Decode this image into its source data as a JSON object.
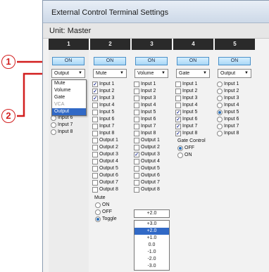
{
  "window": {
    "title": "External Control Terminal Settings",
    "unit_label": "Unit:",
    "unit_value": "Master"
  },
  "callouts": [
    "1",
    "2"
  ],
  "colors": {
    "accent": "#d21e1e",
    "selection": "#3169c6",
    "header": "#2a2a2a",
    "on_button": "#a9d7f6"
  },
  "columns": [
    {
      "number": "1",
      "on_label": "ON",
      "dropdown": "Output",
      "menu": [
        "Mute",
        "Volume",
        "Gate",
        "VCA",
        "Output"
      ],
      "menu_selected": "Output",
      "radios": [
        {
          "label": "Input 6",
          "selected": false
        },
        {
          "label": "Input 7",
          "selected": false
        },
        {
          "label": "Input 8",
          "selected": false
        }
      ]
    },
    {
      "number": "2",
      "on_label": "ON",
      "dropdown": "Mute",
      "items": [
        {
          "label": "Input 1",
          "checked": true
        },
        {
          "label": "Input 2",
          "checked": true
        },
        {
          "label": "Input 3",
          "checked": true
        },
        {
          "label": "Input 4",
          "checked": false
        },
        {
          "label": "Input 5",
          "checked": false
        },
        {
          "label": "Input 6",
          "checked": false
        },
        {
          "label": "Input 7",
          "checked": false
        },
        {
          "label": "Input 8",
          "checked": false
        },
        {
          "label": "Output 1",
          "checked": false
        },
        {
          "label": "Output 2",
          "checked": false
        },
        {
          "label": "Output 3",
          "checked": false
        },
        {
          "label": "Output 4",
          "checked": false
        },
        {
          "label": "Output 5",
          "checked": false
        },
        {
          "label": "Output 6",
          "checked": false
        },
        {
          "label": "Output 7",
          "checked": false
        },
        {
          "label": "Output 8",
          "checked": false
        }
      ],
      "group_label": "Mute",
      "group_options": [
        {
          "label": "ON",
          "selected": false
        },
        {
          "label": "OFF",
          "selected": false
        },
        {
          "label": "Toggle",
          "selected": true
        }
      ]
    },
    {
      "number": "3",
      "on_label": "ON",
      "dropdown": "Volume",
      "items": [
        {
          "label": "Input 1",
          "checked": false
        },
        {
          "label": "Input 2",
          "checked": false
        },
        {
          "label": "Input 3",
          "checked": false
        },
        {
          "label": "Input 4",
          "checked": false
        },
        {
          "label": "Input 5",
          "checked": false
        },
        {
          "label": "Input 6",
          "checked": false
        },
        {
          "label": "Input 7",
          "checked": false
        },
        {
          "label": "Input 8",
          "checked": false
        },
        {
          "label": "Output 1",
          "checked": false
        },
        {
          "label": "Output 2",
          "checked": false
        },
        {
          "label": "Output 3",
          "checked": true
        },
        {
          "label": "Output 4",
          "checked": false
        },
        {
          "label": "Output 5",
          "checked": false
        },
        {
          "label": "Output 6",
          "checked": false
        },
        {
          "label": "Output 7",
          "checked": false
        },
        {
          "label": "Output 8",
          "checked": false
        }
      ],
      "level_value": "+2.0",
      "level_options": [
        "+3.0",
        "+2.0",
        "+1.0",
        "0.0",
        "-1.0",
        "-2.0",
        "-3.0"
      ],
      "level_selected": "+2.0"
    },
    {
      "number": "4",
      "on_label": "ON",
      "dropdown": "Gate",
      "items": [
        {
          "label": "Input 1",
          "checked": false
        },
        {
          "label": "Input 2",
          "checked": false
        },
        {
          "label": "Input 3",
          "checked": false
        },
        {
          "label": "Input 4",
          "checked": false
        },
        {
          "label": "Input 5",
          "checked": true
        },
        {
          "label": "Input 6",
          "checked": true
        },
        {
          "label": "Input 7",
          "checked": true
        },
        {
          "label": "Input 8",
          "checked": true
        }
      ],
      "group_label": "Gate Control",
      "group_options": [
        {
          "label": "OFF",
          "selected": true
        },
        {
          "label": "ON",
          "selected": false
        }
      ]
    },
    {
      "number": "5",
      "on_label": "ON",
      "dropdown": "Output",
      "radios": [
        {
          "label": "Input 1",
          "selected": false
        },
        {
          "label": "Input 2",
          "selected": false
        },
        {
          "label": "Input 3",
          "selected": false
        },
        {
          "label": "Input 4",
          "selected": false
        },
        {
          "label": "Input 5",
          "selected": true
        },
        {
          "label": "Input 6",
          "selected": false
        },
        {
          "label": "Input 7",
          "selected": false
        },
        {
          "label": "Input 8",
          "selected": false
        }
      ]
    }
  ]
}
